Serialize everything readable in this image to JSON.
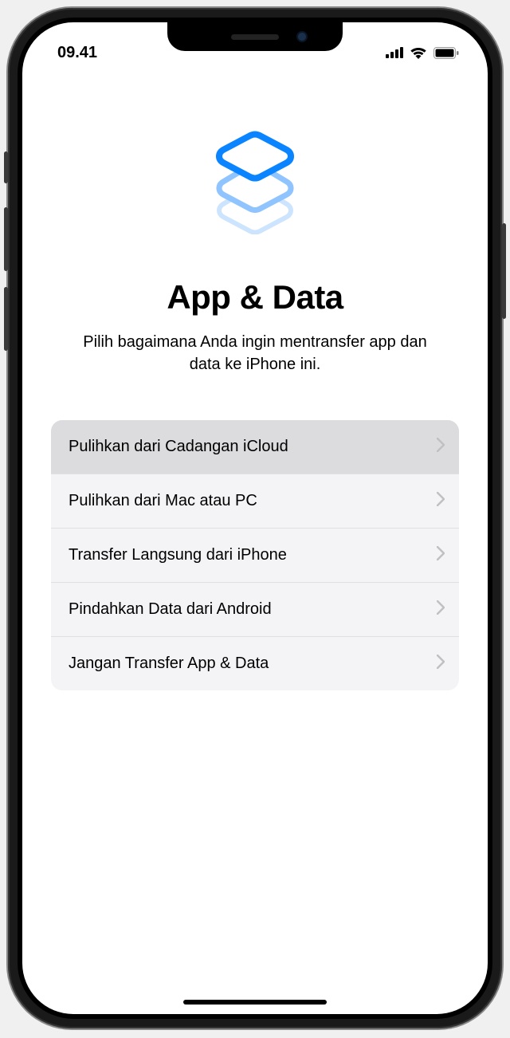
{
  "statusBar": {
    "time": "09.41"
  },
  "header": {
    "title": "App & Data",
    "subtitle": "Pilih bagaimana Anda ingin mentransfer app dan data ke iPhone ini."
  },
  "options": [
    {
      "label": "Pulihkan dari Cadangan iCloud",
      "selected": true
    },
    {
      "label": "Pulihkan dari Mac atau PC",
      "selected": false
    },
    {
      "label": "Transfer Langsung dari iPhone",
      "selected": false
    },
    {
      "label": "Pindahkan Data dari Android",
      "selected": false
    },
    {
      "label": "Jangan Transfer App & Data",
      "selected": false
    }
  ]
}
